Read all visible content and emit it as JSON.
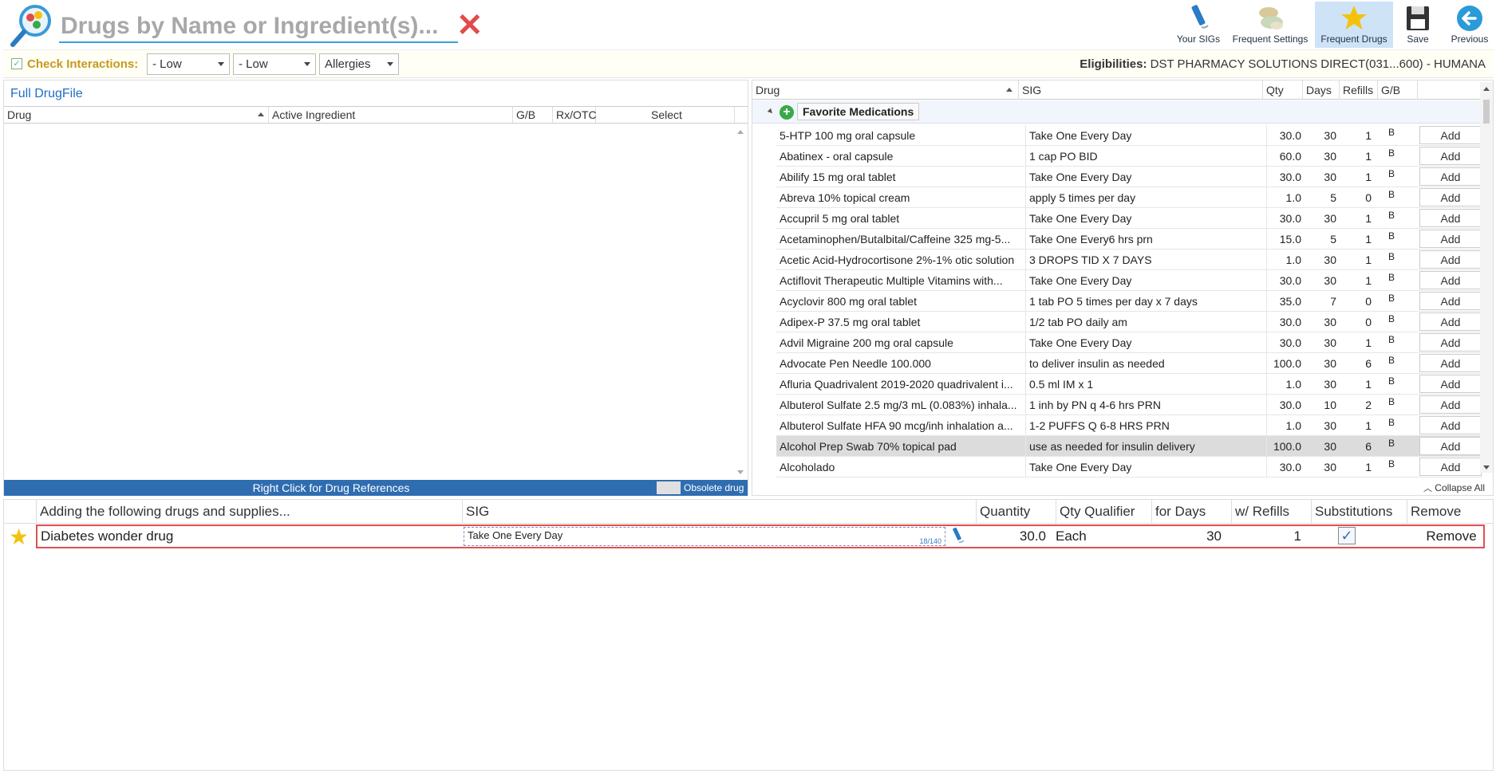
{
  "search": {
    "placeholder": "Drugs by Name or Ingredient(s)..."
  },
  "toolbar": {
    "your_sigs": "Your SIGs",
    "frequent_settings": "Frequent Settings",
    "frequent_drugs": "Frequent Drugs",
    "save": "Save",
    "previous": "Previous"
  },
  "interactions": {
    "label": "Check Interactions:",
    "combo1": "- Low",
    "combo2": "- Low",
    "combo3": "Allergies",
    "elig_label": "Eligibilities:",
    "elig_value": "DST PHARMACY SOLUTIONS DIRECT(031...600) - HUMANA"
  },
  "left": {
    "title": "Full DrugFile",
    "columns": [
      "Drug",
      "Active Ingredient",
      "G/B",
      "Rx/OTC",
      "Select"
    ],
    "footer": "Right Click for Drug References",
    "obsolete": "Obsolete drug"
  },
  "right": {
    "columns": [
      "Drug",
      "SIG",
      "Qty",
      "Days",
      "Refills",
      "G/B"
    ],
    "group": "Favorite Medications",
    "add_label": "Add",
    "collapse_all": "Collapse All",
    "rows": [
      {
        "drug": "5-HTP 100 mg oral capsule",
        "sig": "Take One Every Day",
        "qty": "30.0",
        "days": "30",
        "refills": "1",
        "gb": "B"
      },
      {
        "drug": "Abatinex - oral capsule",
        "sig": "1 cap PO BID",
        "qty": "60.0",
        "days": "30",
        "refills": "1",
        "gb": "B"
      },
      {
        "drug": "Abilify 15 mg oral tablet",
        "sig": "Take One Every Day",
        "qty": "30.0",
        "days": "30",
        "refills": "1",
        "gb": "B"
      },
      {
        "drug": "Abreva 10% topical cream",
        "sig": "apply 5 times per day",
        "qty": "1.0",
        "days": "5",
        "refills": "0",
        "gb": "B"
      },
      {
        "drug": "Accupril 5 mg oral tablet",
        "sig": "Take One Every Day",
        "qty": "30.0",
        "days": "30",
        "refills": "1",
        "gb": "B"
      },
      {
        "drug": "Acetaminophen/Butalbital/Caffeine 325 mg-5...",
        "sig": "Take One Every6 hrs prn",
        "qty": "15.0",
        "days": "5",
        "refills": "1",
        "gb": "B"
      },
      {
        "drug": "Acetic Acid-Hydrocortisone 2%-1% otic solution",
        "sig": "3 DROPS TID X 7 DAYS",
        "qty": "1.0",
        "days": "30",
        "refills": "1",
        "gb": "B"
      },
      {
        "drug": "Actiflovit Therapeutic Multiple Vitamins with...",
        "sig": "Take One Every Day",
        "qty": "30.0",
        "days": "30",
        "refills": "1",
        "gb": "B"
      },
      {
        "drug": "Acyclovir 800 mg oral tablet",
        "sig": "1 tab PO 5 times per day x 7 days",
        "qty": "35.0",
        "days": "7",
        "refills": "0",
        "gb": "B"
      },
      {
        "drug": "Adipex-P 37.5 mg oral tablet",
        "sig": "1/2 tab PO daily am",
        "qty": "30.0",
        "days": "30",
        "refills": "0",
        "gb": "B"
      },
      {
        "drug": "Advil Migraine 200 mg oral capsule",
        "sig": "Take One Every Day",
        "qty": "30.0",
        "days": "30",
        "refills": "1",
        "gb": "B"
      },
      {
        "drug": "Advocate Pen Needle 100.000",
        "sig": "to deliver insulin as needed",
        "qty": "100.0",
        "days": "30",
        "refills": "6",
        "gb": "B"
      },
      {
        "drug": "Afluria Quadrivalent 2019-2020 quadrivalent i...",
        "sig": "0.5 ml IM x 1",
        "qty": "1.0",
        "days": "30",
        "refills": "1",
        "gb": "B"
      },
      {
        "drug": "Albuterol Sulfate 2.5 mg/3 mL (0.083%) inhala...",
        "sig": "1 inh by PN q 4-6 hrs PRN",
        "qty": "30.0",
        "days": "10",
        "refills": "2",
        "gb": "B"
      },
      {
        "drug": "Albuterol Sulfate HFA 90 mcg/inh inhalation a...",
        "sig": "1-2 PUFFS Q 6-8 HRS PRN",
        "qty": "1.0",
        "days": "30",
        "refills": "1",
        "gb": "B"
      },
      {
        "drug": "Alcohol Prep Swab 70% topical pad",
        "sig": "use as needed for insulin delivery",
        "qty": "100.0",
        "days": "30",
        "refills": "6",
        "gb": "B"
      },
      {
        "drug": "Alcoholado",
        "sig": "Take One Every Day",
        "qty": "30.0",
        "days": "30",
        "refills": "1",
        "gb": "B"
      }
    ]
  },
  "bottom": {
    "columns": [
      "Adding the following drugs and supplies...",
      "SIG",
      "Quantity",
      "Qty Qualifier",
      "for Days",
      "w/ Refills",
      "Substitutions",
      "Remove"
    ],
    "row": {
      "drug": "Diabetes wonder drug",
      "sig": "Take One Every Day",
      "sig_count": "18/140",
      "quantity": "30.0",
      "qualifier": "Each",
      "days": "30",
      "refills": "1",
      "substitutions": "✓",
      "remove": "Remove"
    }
  },
  "colors": {
    "accent": "#2f6db1",
    "highlight_border": "#e05050",
    "interactions_label": "#c49a1e",
    "star": "#f4c20d"
  }
}
